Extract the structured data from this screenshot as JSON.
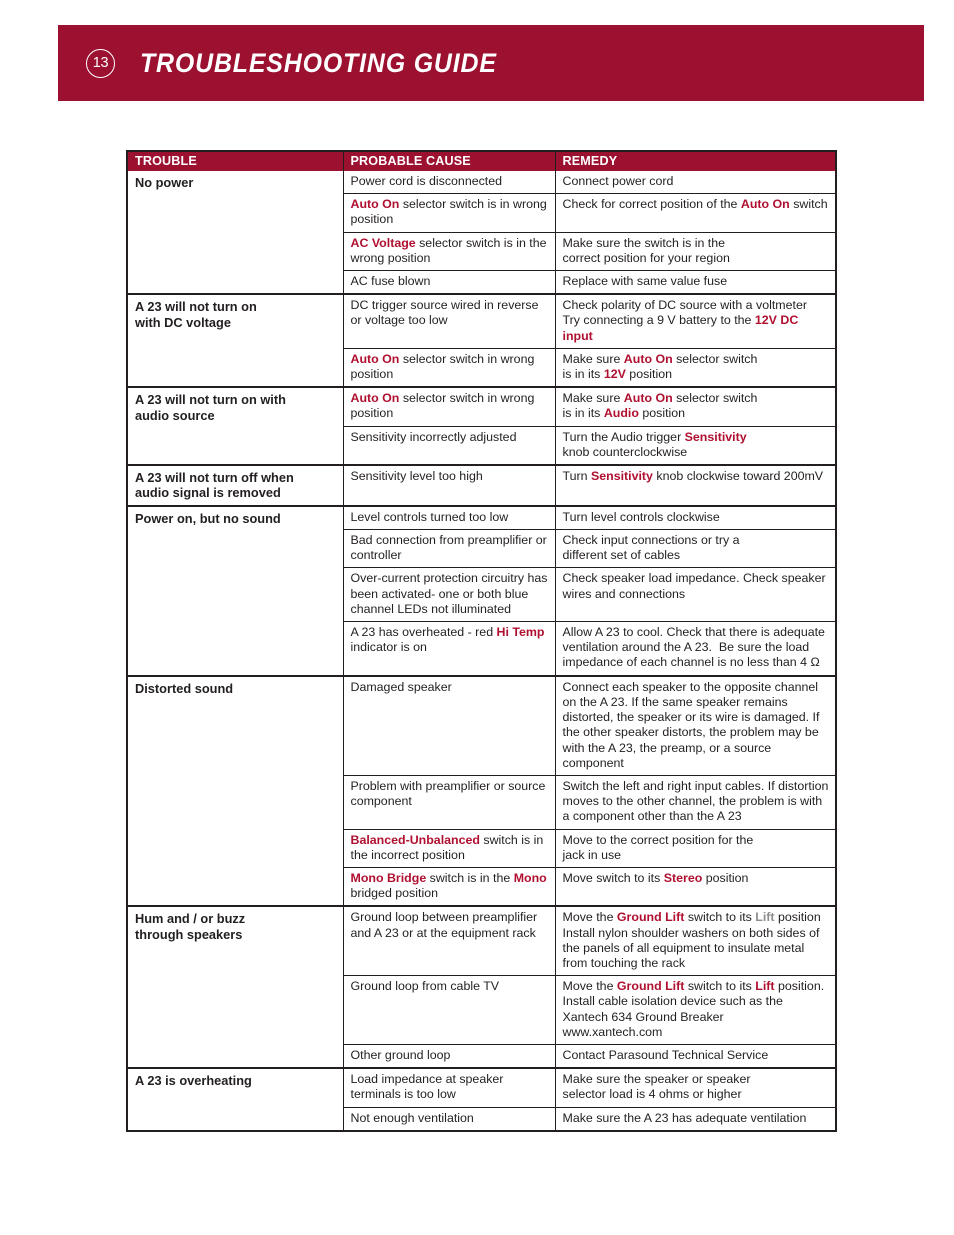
{
  "header": {
    "page_number": "13",
    "title": "TROUBLESHOOTING GUIDE",
    "banner_color": "#9c1030"
  },
  "accent": {
    "red": "#b01030",
    "grey": "#8e8e8e",
    "ink": "#231f20"
  },
  "table": {
    "columns": [
      "TROUBLE",
      "PROBABLE CAUSE",
      "REMEDY"
    ],
    "groups": [
      {
        "trouble": "No power",
        "rows": [
          {
            "cause_html": "Power cord is disconnected",
            "remedy_html": "Connect power cord"
          },
          {
            "cause_html": "<span class=\"em\">Auto On</span> selector switch is in wrong position",
            "remedy_html": "Check for correct position of the <span class=\"em\">Auto On</span> switch"
          },
          {
            "cause_html": "<span class=\"em\">AC Voltage</span> selector switch is in the wrong position",
            "remedy_html": "Make sure the switch is in the<br>correct position for your region"
          },
          {
            "cause_html": "AC fuse blown",
            "remedy_html": "Replace with same value fuse"
          }
        ]
      },
      {
        "trouble": "A 23 will not turn on<br>with DC voltage",
        "rows": [
          {
            "cause_html": "DC trigger source wired in reverse<br>or voltage too low",
            "remedy_html": "Check polarity of DC source with a voltmeter<br>Try connecting a 9 V battery to the <span class=\"em\">12V DC input</span>"
          },
          {
            "cause_html": "<span class=\"em\">Auto On</span> selector switch in wrong position",
            "remedy_html": "Make sure <span class=\"em\">Auto On</span> selector switch<br>is in its <span class=\"em\">12V</span> position"
          }
        ]
      },
      {
        "trouble": "A 23 will not turn on with<br>audio source",
        "rows": [
          {
            "cause_html": "<span class=\"em\">Auto On</span> selector switch in wrong position",
            "remedy_html": "Make sure <span class=\"em\">Auto On</span> selector switch<br>is in its <span class=\"em\">Audio</span> position"
          },
          {
            "cause_html": "Sensitivity incorrectly adjusted",
            "remedy_html": "Turn the Audio trigger <span class=\"em\">Sensitivity</span><br>knob counterclockwise"
          }
        ]
      },
      {
        "trouble": "A 23 will not turn off when<br>audio signal is removed",
        "rows": [
          {
            "cause_html": "Sensitivity level too high",
            "remedy_html": "Turn <span class=\"em\">Sensitivity</span> knob clockwise toward 200mV"
          }
        ]
      },
      {
        "trouble": "Power on, but no sound",
        "rows": [
          {
            "cause_html": "Level controls turned too low",
            "remedy_html": "Turn level controls clockwise"
          },
          {
            "cause_html": "Bad connection from preamplifier or controller",
            "remedy_html": "Check input connections or try a<br>different set of cables"
          },
          {
            "cause_html": "Over-current protection circuitry has been activated- one or both blue channel LEDs not illuminated",
            "remedy_html": "Check speaker load impedance. Check speaker wires and connections"
          },
          {
            "cause_html": "A 23 has overheated - red <span class=\"em\">Hi Temp</span><br>indicator is on",
            "remedy_html": "Allow A 23 to cool. Check that there is adequate ventilation around the A 23.&nbsp; Be sure the load impedance of each channel is no less than 4 Ω"
          }
        ]
      },
      {
        "trouble": "Distorted sound",
        "rows": [
          {
            "cause_html": "Damaged speaker",
            "remedy_html": "Connect each speaker to the opposite channel on the A 23. If the same speaker remains distorted, the speaker or its wire is damaged. If the other speaker distorts, the problem may be with the A 23, the preamp, or a source component"
          },
          {
            "cause_html": "Problem with preamplifier or source component",
            "remedy_html": "Switch the left and right input cables. If distortion moves to the other channel, the problem is with a component other than the A 23"
          },
          {
            "cause_html": "<span class=\"em\">Balanced-Unbalanced</span> switch is in the incorrect position",
            "remedy_html": "Move to the correct position for the<br>jack in use"
          },
          {
            "cause_html": "<span class=\"em\">Mono Bridge</span> switch is in the <span class=\"em\">Mono</span> bridged position",
            "remedy_html": "Move switch to its <span class=\"em\">Stereo</span> position"
          }
        ]
      },
      {
        "trouble": "Hum and / or buzz<br>through speakers",
        "rows": [
          {
            "cause_html": "Ground loop between preamplifier and A 23 or at the equipment rack",
            "remedy_html": "Move the <span class=\"em\">Ground Lift</span> switch to its <span class=\"emg\">Lift</span> position Install nylon shoulder washers on both sides of the panels of all equipment to insulate metal from touching the rack"
          },
          {
            "cause_html": "Ground loop from cable TV",
            "remedy_html": "Move the <span class=\"em\">Ground Lift</span> switch to its <span class=\"em\">Lift</span> position. Install cable isolation device such as the Xantech 634 Ground Breaker<br>www.xantech.com"
          },
          {
            "cause_html": "Other ground loop",
            "remedy_html": "Contact Parasound Technical Service"
          }
        ]
      },
      {
        "trouble": "A 23 is overheating",
        "rows": [
          {
            "cause_html": "Load impedance at speaker terminals is too low",
            "remedy_html": "Make sure the speaker or speaker<br>selector load is 4 ohms or higher"
          },
          {
            "cause_html": "Not enough ventilation",
            "remedy_html": "Make sure the A 23 has adequate ventilation"
          }
        ]
      }
    ]
  }
}
